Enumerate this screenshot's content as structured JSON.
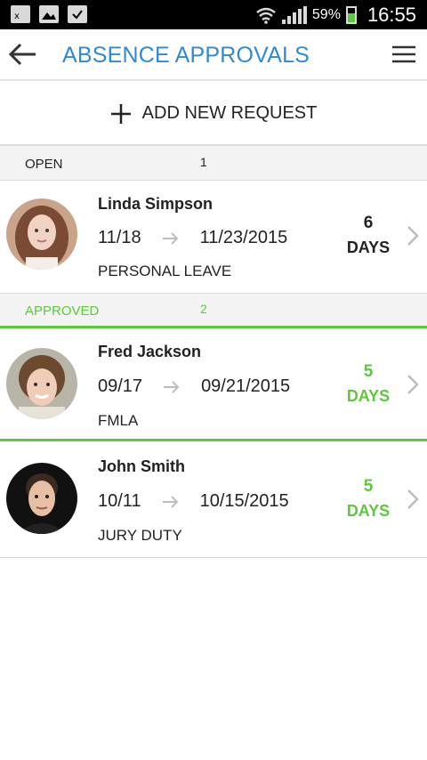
{
  "status_bar": {
    "battery": "59%",
    "time": "16:55",
    "icons": [
      "sim-alert-icon",
      "image-icon",
      "clipboard-icon",
      "wifi-icon",
      "signal-icon",
      "battery-icon"
    ]
  },
  "header": {
    "title": "ABSENCE APPROVALS",
    "back_icon": "arrow-left-icon",
    "menu_icon": "hamburger-menu-icon"
  },
  "add_request": {
    "label": "ADD NEW REQUEST",
    "icon": "plus-icon"
  },
  "sections": {
    "open": {
      "label": "OPEN",
      "count": "1",
      "color": "#222222"
    },
    "approved": {
      "label": "APPROVED",
      "count": "2",
      "color": "#5cc83a"
    }
  },
  "requests": [
    {
      "name": "Linda Simpson",
      "start": "11/18",
      "end": "11/23/2015",
      "type": "PERSONAL LEAVE",
      "days": "6",
      "days_unit": "DAYS",
      "status": "open"
    },
    {
      "name": "Fred Jackson",
      "start": "09/17",
      "end": "09/21/2015",
      "type": "FMLA",
      "days": "5",
      "days_unit": "DAYS",
      "status": "approved"
    },
    {
      "name": "John Smith",
      "start": "10/11",
      "end": "10/15/2015",
      "type": "JURY DUTY",
      "days": "5",
      "days_unit": "DAYS",
      "status": "approved"
    }
  ],
  "colors": {
    "accent": "#2e8ad8",
    "approved_green": "#5cc83a",
    "section_bg": "#f3f3f3"
  }
}
